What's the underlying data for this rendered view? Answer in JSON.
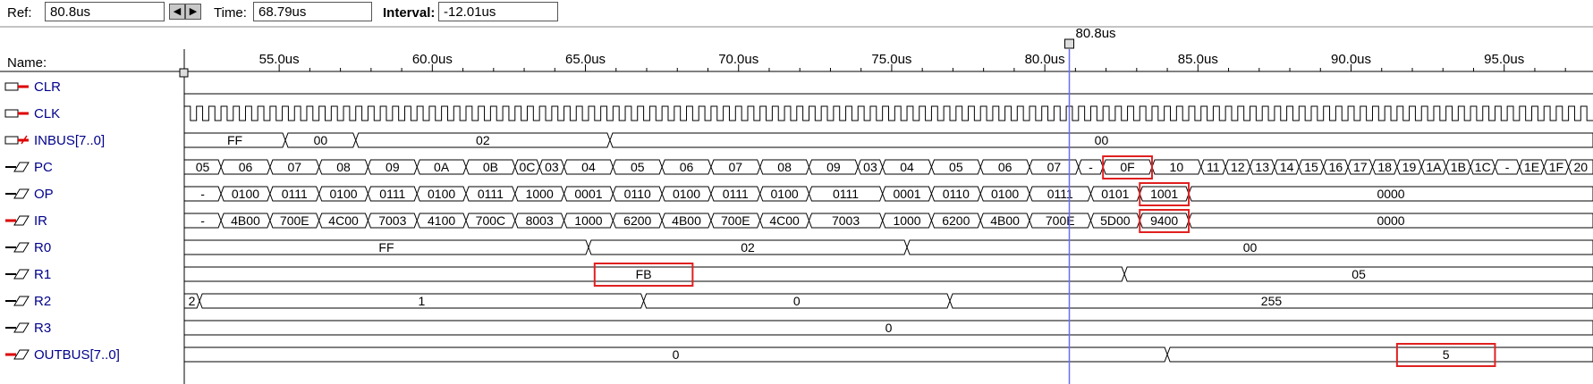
{
  "toolbar": {
    "ref_label": "Ref:",
    "ref_value": "80.8us",
    "time_label": "Time:",
    "time_value": "68.79us",
    "interval_label": "Interval:",
    "interval_value": "-12.01us"
  },
  "cursor": {
    "label": "80.8us",
    "time_us": 80.8
  },
  "names_header": "Name:",
  "time_axis": {
    "start_us": 51.9,
    "end_us": 97.9,
    "ticks": [
      {
        "t": 55,
        "label": "55.0us"
      },
      {
        "t": 60,
        "label": "60.0us"
      },
      {
        "t": 65,
        "label": "65.0us"
      },
      {
        "t": 70,
        "label": "70.0us"
      },
      {
        "t": 75,
        "label": "75.0us"
      },
      {
        "t": 80,
        "label": "80.0us"
      },
      {
        "t": 85,
        "label": "85.0us"
      },
      {
        "t": 90,
        "label": "90.0us"
      },
      {
        "t": 95,
        "label": "95.0us"
      }
    ]
  },
  "colors": {
    "signal_name": "#00008b",
    "cursor": "#6a6aff",
    "highlight": "#e02020",
    "wave": "#000000"
  },
  "signals": [
    {
      "name": "CLR",
      "icon": "input-pin-icon",
      "kind": "low"
    },
    {
      "name": "CLK",
      "icon": "input-pin-icon",
      "kind": "clock"
    },
    {
      "name": "INBUS[7..0]",
      "icon": "input-bus-icon",
      "kind": "bus",
      "segs": [
        {
          "end": 55.2,
          "v": "FF"
        },
        {
          "end": 57.5,
          "v": "00"
        },
        {
          "end": 65.8,
          "v": "02"
        },
        {
          "end": 97.9,
          "v": "00"
        }
      ]
    },
    {
      "name": "PC",
      "icon": "output-pin-icon",
      "kind": "bus",
      "segs": [
        {
          "end": 53.1,
          "v": "05"
        },
        {
          "end": 54.7,
          "v": "06"
        },
        {
          "end": 56.3,
          "v": "07"
        },
        {
          "end": 57.9,
          "v": "08"
        },
        {
          "end": 59.5,
          "v": "09"
        },
        {
          "end": 61.1,
          "v": "0A"
        },
        {
          "end": 62.7,
          "v": "0B"
        },
        {
          "end": 63.5,
          "v": "0C"
        },
        {
          "end": 64.3,
          "v": "03"
        },
        {
          "end": 65.9,
          "v": "04"
        },
        {
          "end": 67.5,
          "v": "05"
        },
        {
          "end": 69.1,
          "v": "06"
        },
        {
          "end": 70.7,
          "v": "07"
        },
        {
          "end": 72.3,
          "v": "08"
        },
        {
          "end": 73.9,
          "v": "09"
        },
        {
          "end": 74.7,
          "v": "03"
        },
        {
          "end": 76.3,
          "v": "04"
        },
        {
          "end": 77.9,
          "v": "05"
        },
        {
          "end": 79.5,
          "v": "06"
        },
        {
          "end": 81.1,
          "v": "07"
        },
        {
          "end": 81.9,
          "v": "-"
        },
        {
          "end": 83.5,
          "v": "0F"
        },
        {
          "end": 85.1,
          "v": "10"
        },
        {
          "end": 85.9,
          "v": "11"
        },
        {
          "end": 86.7,
          "v": "12"
        },
        {
          "end": 87.5,
          "v": "13"
        },
        {
          "end": 88.3,
          "v": "14"
        },
        {
          "end": 89.1,
          "v": "15"
        },
        {
          "end": 89.9,
          "v": "16"
        },
        {
          "end": 90.7,
          "v": "17"
        },
        {
          "end": 91.5,
          "v": "18"
        },
        {
          "end": 92.3,
          "v": "19"
        },
        {
          "end": 93.1,
          "v": "1A"
        },
        {
          "end": 93.9,
          "v": "1B"
        },
        {
          "end": 94.7,
          "v": "1C"
        },
        {
          "end": 95.5,
          "v": "-"
        },
        {
          "end": 96.3,
          "v": "1E"
        },
        {
          "end": 97.1,
          "v": "1F"
        },
        {
          "end": 97.9,
          "v": "20"
        }
      ]
    },
    {
      "name": "OP",
      "icon": "output-pin-icon",
      "kind": "bus",
      "segs": [
        {
          "end": 53.1,
          "v": "-"
        },
        {
          "end": 54.7,
          "v": "0100"
        },
        {
          "end": 56.3,
          "v": "0111"
        },
        {
          "end": 57.9,
          "v": "0100"
        },
        {
          "end": 59.5,
          "v": "0111"
        },
        {
          "end": 61.1,
          "v": "0100"
        },
        {
          "end": 62.7,
          "v": "0111"
        },
        {
          "end": 64.3,
          "v": "1000"
        },
        {
          "end": 65.9,
          "v": "0001"
        },
        {
          "end": 67.5,
          "v": "0110"
        },
        {
          "end": 69.1,
          "v": "0100"
        },
        {
          "end": 70.7,
          "v": "0111"
        },
        {
          "end": 72.3,
          "v": "0100"
        },
        {
          "end": 74.7,
          "v": "0111"
        },
        {
          "end": 76.3,
          "v": "0001"
        },
        {
          "end": 77.9,
          "v": "0110"
        },
        {
          "end": 79.5,
          "v": "0100"
        },
        {
          "end": 81.5,
          "v": "0111"
        },
        {
          "end": 83.1,
          "v": "0101"
        },
        {
          "end": 84.7,
          "v": "1001"
        },
        {
          "end": 97.9,
          "v": "0000"
        }
      ]
    },
    {
      "name": "IR",
      "icon": "output-bus-icon",
      "kind": "bus",
      "segs": [
        {
          "end": 53.1,
          "v": "-"
        },
        {
          "end": 54.7,
          "v": "4B00"
        },
        {
          "end": 56.3,
          "v": "700E"
        },
        {
          "end": 57.9,
          "v": "4C00"
        },
        {
          "end": 59.5,
          "v": "7003"
        },
        {
          "end": 61.1,
          "v": "4100"
        },
        {
          "end": 62.7,
          "v": "700C"
        },
        {
          "end": 64.3,
          "v": "8003"
        },
        {
          "end": 65.9,
          "v": "1000"
        },
        {
          "end": 67.5,
          "v": "6200"
        },
        {
          "end": 69.1,
          "v": "4B00"
        },
        {
          "end": 70.7,
          "v": "700E"
        },
        {
          "end": 72.3,
          "v": "4C00"
        },
        {
          "end": 74.7,
          "v": "7003"
        },
        {
          "end": 76.3,
          "v": "1000"
        },
        {
          "end": 77.9,
          "v": "6200"
        },
        {
          "end": 79.5,
          "v": "4B00"
        },
        {
          "end": 81.5,
          "v": "700E"
        },
        {
          "end": 83.1,
          "v": "5D00"
        },
        {
          "end": 84.7,
          "v": "9400"
        },
        {
          "end": 97.9,
          "v": "0000"
        }
      ]
    },
    {
      "name": "R0",
      "icon": "output-pin-icon",
      "kind": "bus",
      "segs": [
        {
          "end": 65.1,
          "v": "FF"
        },
        {
          "end": 75.5,
          "v": "02"
        },
        {
          "end": 97.9,
          "v": "00"
        }
      ]
    },
    {
      "name": "R1",
      "icon": "output-pin-icon",
      "kind": "bus",
      "segs": [
        {
          "end": 82.6,
          "v": "FB"
        },
        {
          "end": 97.9,
          "v": "05"
        }
      ],
      "label_at": [
        [
          65.3,
          68.5
        ],
        [
          82.6,
          97.9
        ]
      ]
    },
    {
      "name": "R2",
      "icon": "output-pin-icon",
      "kind": "bus",
      "segs": [
        {
          "end": 52.4,
          "v": "2"
        },
        {
          "end": 66.9,
          "v": "1"
        },
        {
          "end": 76.9,
          "v": "0"
        },
        {
          "end": 97.9,
          "v": "255"
        }
      ]
    },
    {
      "name": "R3",
      "icon": "output-pin-icon",
      "kind": "bus",
      "segs": [
        {
          "end": 97.9,
          "v": "0"
        }
      ]
    },
    {
      "name": "OUTBUS[7..0]",
      "icon": "output-bus-icon",
      "kind": "bus",
      "segs": [
        {
          "end": 84.0,
          "v": "0"
        },
        {
          "end": 97.9,
          "v": "5"
        }
      ],
      "label_at": [
        [
          51.9,
          84.0
        ],
        [
          91.5,
          94.7
        ]
      ]
    }
  ],
  "highlights": [
    {
      "row": 3,
      "t0": 81.9,
      "t1": 83.5
    },
    {
      "row": 4,
      "t0": 83.1,
      "t1": 84.7
    },
    {
      "row": 5,
      "t0": 83.1,
      "t1": 84.7
    },
    {
      "row": 7,
      "t0": 65.3,
      "t1": 68.5
    },
    {
      "row": 10,
      "t0": 91.5,
      "t1": 94.7
    }
  ]
}
